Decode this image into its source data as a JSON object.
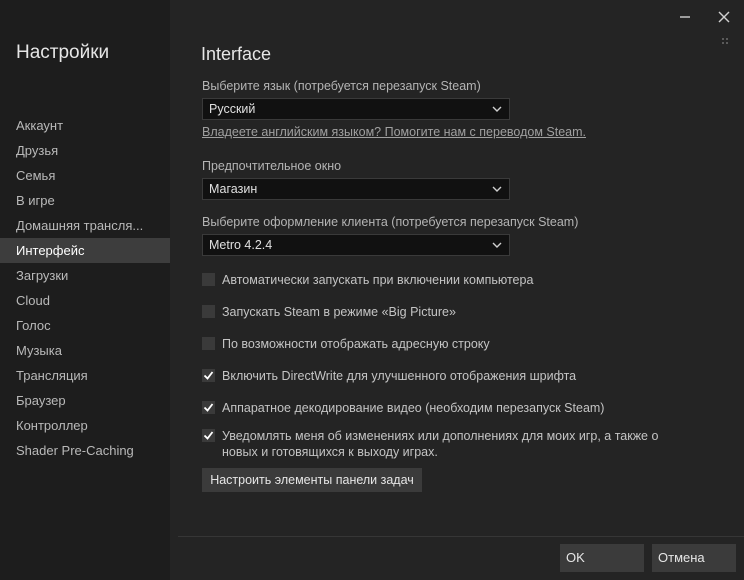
{
  "sidebar": {
    "title": "Настройки",
    "items": [
      {
        "label": "Аккаунт"
      },
      {
        "label": "Друзья"
      },
      {
        "label": "Семья"
      },
      {
        "label": "В игре"
      },
      {
        "label": "Домашняя трансля..."
      },
      {
        "label": "Интерфейс",
        "active": true
      },
      {
        "label": "Загрузки"
      },
      {
        "label": "Cloud"
      },
      {
        "label": "Голос"
      },
      {
        "label": "Музыка"
      },
      {
        "label": "Трансляция"
      },
      {
        "label": "Браузер"
      },
      {
        "label": "Контроллер"
      },
      {
        "label": "Shader Pre-Caching"
      }
    ]
  },
  "window": {
    "minimize_icon": "minimize-icon",
    "close_icon": "close-icon"
  },
  "main": {
    "title": "Interface",
    "language": {
      "label": "Выберите язык (потребуется перезапуск Steam)",
      "value": "Русский"
    },
    "translate_link": "Владеете английским языком? Помогите нам с переводом Steam.",
    "window_pref": {
      "label": "Предпочтительное окно",
      "value": "Магазин"
    },
    "skin": {
      "label": "Выберите оформление клиента (потребуется перезапуск Steam)",
      "value": "Metro 4.2.4"
    },
    "checkboxes": [
      {
        "label": "Автоматически запускать при включении компьютера",
        "checked": false
      },
      {
        "label": "Запускать Steam в режиме «Big Picture»",
        "checked": false
      },
      {
        "label": "По возможности отображать адресную строку",
        "checked": false
      },
      {
        "label": "Включить DirectWrite для улучшенного отображения шрифта",
        "checked": true
      },
      {
        "label": "Аппаратное декодирование видео (необходим перезапуск Steam)",
        "checked": true
      },
      {
        "label": "Уведомлять меня об изменениях или дополнениях для моих игр, а также о",
        "label2": "новых и готовящихся к выходу играх.",
        "checked": true
      }
    ],
    "taskbar_button": "Настроить элементы панели задач"
  },
  "footer": {
    "ok": "OK",
    "cancel": "Отмена"
  },
  "colors": {
    "bg_sidebar": "#1d1d1d",
    "bg_main": "#242424",
    "active": "#3d3d3d",
    "button": "#3b3b3b"
  }
}
